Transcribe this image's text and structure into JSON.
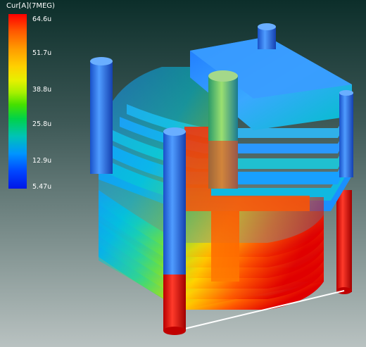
{
  "legend": {
    "title": "Cur[A](7MEG)",
    "ticks": [
      "64.6u",
      "51.7u",
      "38.8u",
      "25.8u",
      "12.9u",
      "5.47u"
    ],
    "colors": [
      "#ff0000",
      "#ffa000",
      "#e6f000",
      "#44e000",
      "#00c3b6",
      "#0094ff",
      "#0016e8"
    ]
  },
  "scene": {
    "description_icon": "3d-coil-current-density-icon",
    "plate_count": 12,
    "pillar_colors": [
      "#2a6fe0",
      "#2a6fe0",
      "#4a8ad8",
      "#2a6fe0",
      "#2a6fe0",
      "#e01010"
    ]
  }
}
